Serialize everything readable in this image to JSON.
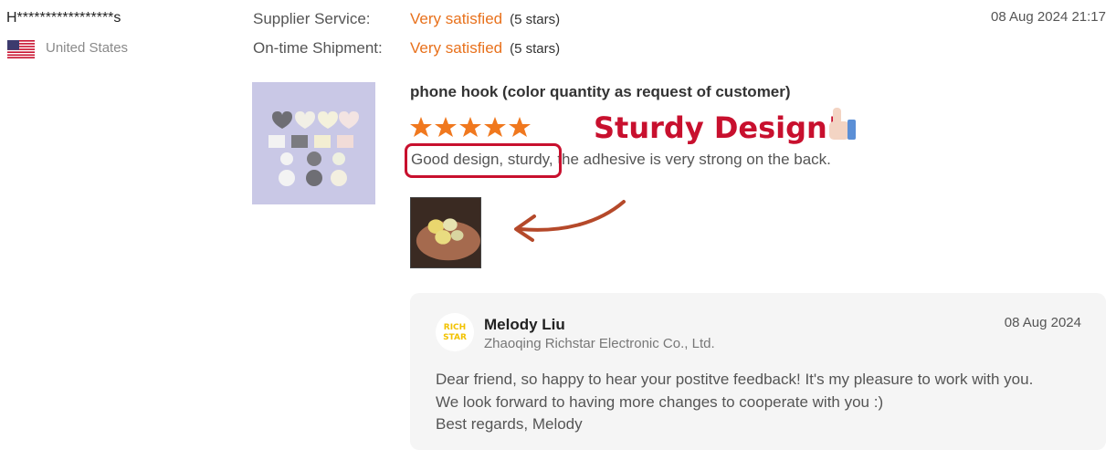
{
  "reviewer": {
    "name": "H*****************s",
    "country": "United States",
    "flag_icon": "us-flag-icon"
  },
  "ratings": [
    {
      "label": "Supplier Service:",
      "value": "Very satisfied",
      "stars_text": "(5 stars)"
    },
    {
      "label": "On-time Shipment:",
      "value": "Very satisfied",
      "stars_text": "(5 stars)"
    }
  ],
  "review": {
    "date": "08 Aug 2024 21:17",
    "product_name": "phone hook (color quantity as request of customer)",
    "star_count": 5,
    "star_icon": "star-icon",
    "text": "Good design, sturdy, the adhesive is very strong on the back."
  },
  "annotation": {
    "sticker_text": "Sturdy Design!",
    "sticker_icon": "thumbs-up-icon",
    "arrow_icon": "curved-arrow-icon"
  },
  "reply": {
    "name": "Melody Liu",
    "company": "Zhaoqing Richstar Electronic Co., Ltd.",
    "date": "08 Aug 2024",
    "text": "Dear friend, so happy to hear your postitve feedback! It's my pleasure to work with you.\nWe look forward to having more changes to cooperate with you :)\nBest regards, Melody",
    "avatar_text": "RICH STAR"
  },
  "colors": {
    "accent": "#e8711c",
    "highlight": "#c8102e",
    "reply_bg": "#f5f5f5"
  }
}
